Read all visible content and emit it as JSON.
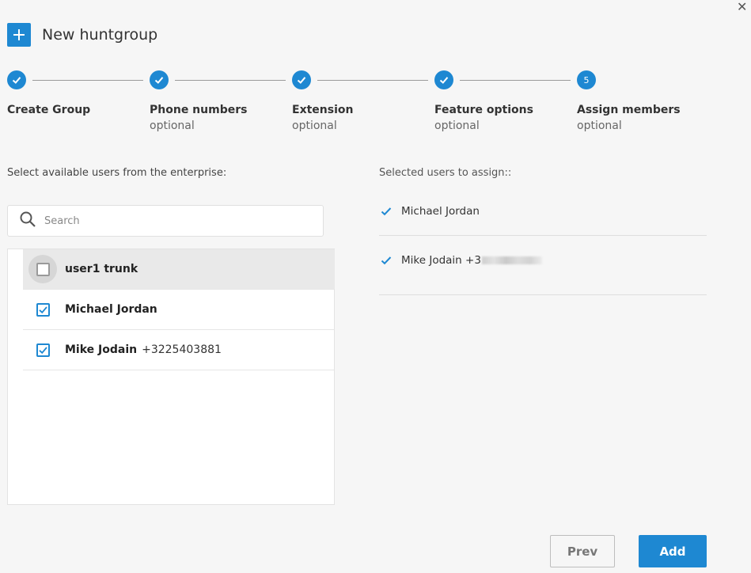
{
  "dialog": {
    "title": "New huntgroup"
  },
  "stepper": {
    "steps": [
      {
        "title": "Create Group",
        "subtitle": "",
        "state": "done"
      },
      {
        "title": "Phone numbers",
        "subtitle": "optional",
        "state": "done"
      },
      {
        "title": "Extension",
        "subtitle": "optional",
        "state": "done"
      },
      {
        "title": "Feature options",
        "subtitle": "optional",
        "state": "done"
      },
      {
        "title": "Assign members",
        "subtitle": "optional",
        "state": "active",
        "number": "5"
      }
    ]
  },
  "available": {
    "label": "Select available users from the enterprise:",
    "search_placeholder": "Search",
    "users": [
      {
        "name": "user1 trunk",
        "number": "",
        "checked": false
      },
      {
        "name": "Michael Jordan",
        "number": "",
        "checked": true
      },
      {
        "name": "Mike Jodain",
        "number": "+3225403881",
        "checked": true
      }
    ]
  },
  "selected": {
    "label": "Selected users to assign::",
    "users": [
      {
        "name": "Michael Jordan"
      },
      {
        "name": "Mike Jodain +3"
      }
    ]
  },
  "buttons": {
    "prev": "Prev",
    "add": "Add"
  },
  "colors": {
    "accent": "#1e88d2",
    "background": "#f6f6f6"
  }
}
